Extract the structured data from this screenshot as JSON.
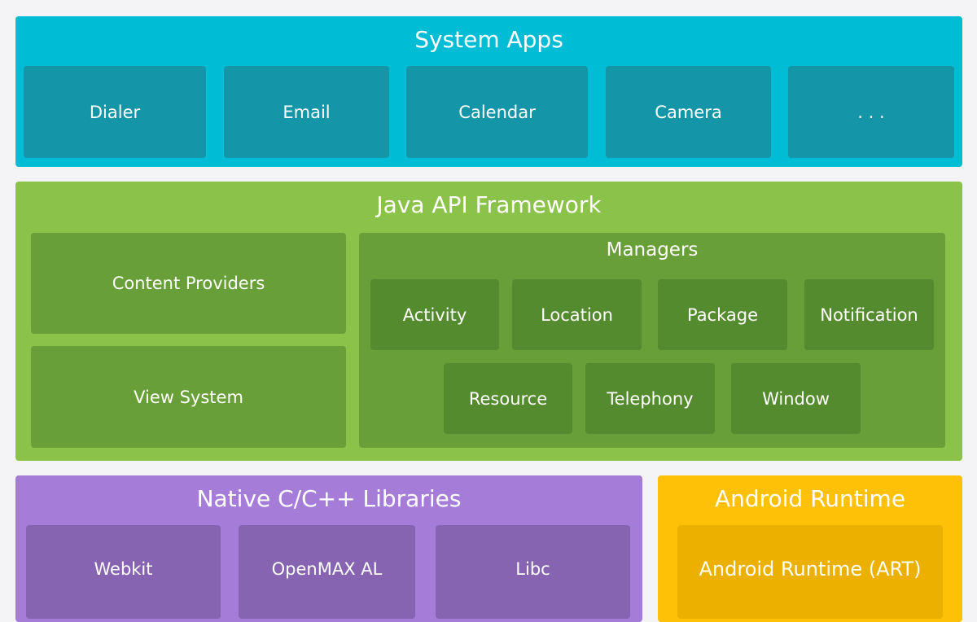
{
  "colors": {
    "system_apps": "#00bcd4",
    "system_item": "#1496a8",
    "java": "#8bc34a",
    "java_item": "#689f38",
    "manager_item": "#558b2f",
    "native": "#a67cd9",
    "native_item": "#8764b1",
    "runtime": "#ffc107",
    "runtime_item": "#ebb000"
  },
  "system_apps": {
    "title": "System Apps",
    "items": [
      "Dialer",
      "Email",
      "Calendar",
      "Camera",
      ". . ."
    ]
  },
  "java": {
    "title": "Java API Framework",
    "content_providers": "Content Providers",
    "view_system": "View System",
    "managers": {
      "title": "Managers",
      "items": [
        "Activity",
        "Location",
        "Package",
        "Notification",
        "Resource",
        "Telephony",
        "Window"
      ]
    }
  },
  "native": {
    "title": "Native C/C++ Libraries",
    "items": [
      "Webkit",
      "OpenMAX AL",
      "Libc"
    ]
  },
  "runtime": {
    "title": "Android Runtime",
    "art": "Android Runtime (ART)"
  }
}
